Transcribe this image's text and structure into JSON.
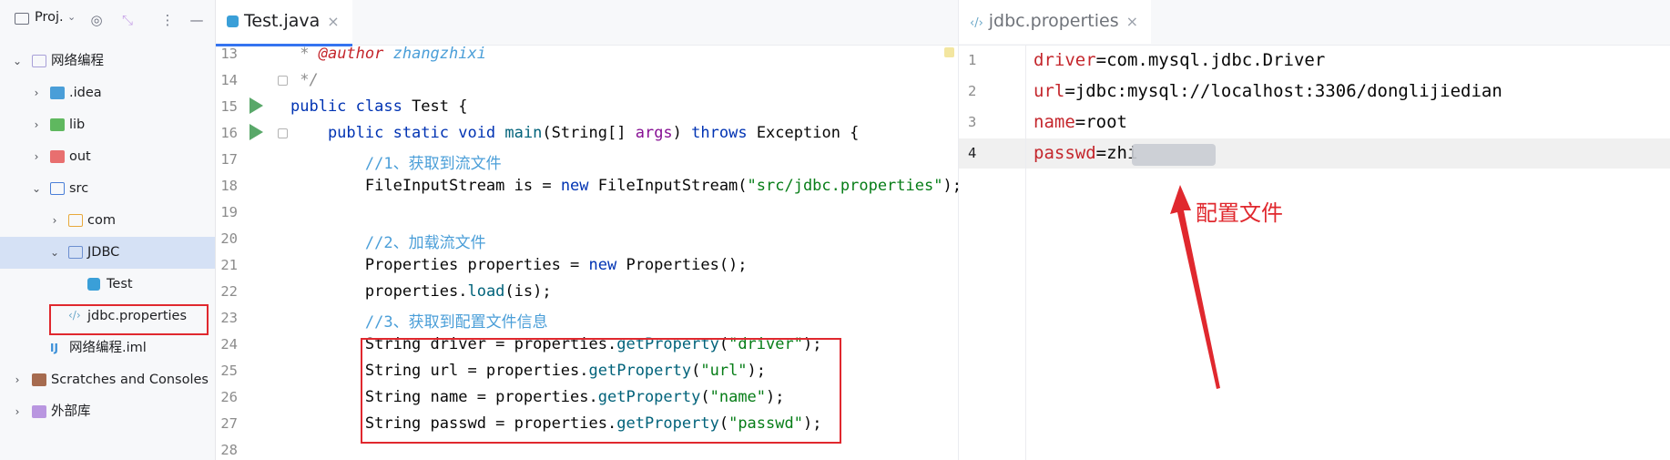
{
  "project": {
    "title": "Proj.",
    "tree": [
      {
        "label": "网络编程",
        "depth": 0,
        "expanded": true,
        "icon": "module-folder-icon"
      },
      {
        "label": ".idea",
        "depth": 1,
        "expanded": false,
        "icon": "idea-folder-icon"
      },
      {
        "label": "lib",
        "depth": 1,
        "expanded": false,
        "icon": "lib-folder-icon"
      },
      {
        "label": "out",
        "depth": 1,
        "expanded": false,
        "icon": "out-folder-icon"
      },
      {
        "label": "src",
        "depth": 1,
        "expanded": true,
        "icon": "source-folder-icon"
      },
      {
        "label": "com",
        "depth": 2,
        "expanded": false,
        "icon": "package-icon"
      },
      {
        "label": "JDBC",
        "depth": 2,
        "expanded": true,
        "icon": "package-icon",
        "selected": true
      },
      {
        "label": "Test",
        "depth": 3,
        "icon": "java-class-icon"
      },
      {
        "label": "jdbc.properties",
        "depth": 2,
        "icon": "properties-file-icon",
        "highlighted": true
      },
      {
        "label": "网络编程.iml",
        "depth": 1,
        "icon": "iml-file-icon"
      },
      {
        "label": "Scratches and Consoles",
        "depth": 0,
        "expanded": false,
        "icon": "scratches-icon"
      },
      {
        "label": "外部库",
        "depth": 0,
        "expanded": false,
        "icon": "external-libraries-icon"
      }
    ]
  },
  "editor_left": {
    "tab_label": "Test.java",
    "lines": [
      "13",
      "14",
      "15",
      "16",
      "17",
      "18",
      "19",
      "20",
      "21",
      "22",
      "23",
      "24",
      "25",
      "26",
      "27",
      "28"
    ],
    "code": {
      "l13_a": " * ",
      "l13_b": "@author",
      "l13_c": " zhangzhixi",
      "l14": " */",
      "l15_kw": "public class ",
      "l15_rest": "Test {",
      "l16_kw": "    public static void ",
      "l16_fn": "main",
      "l16_b": "(String[] ",
      "l16_par": "args",
      "l16_c": ") ",
      "l16_kw2": "throws ",
      "l16_d": "Exception {",
      "l17": "        //1、获取到流文件",
      "l18_a": "        FileInputStream is = ",
      "l18_kw": "new ",
      "l18_b": "FileInputStream(",
      "l18_str": "\"src/jdbc.properties\"",
      "l18_c": ");",
      "l20": "        //2、加载流文件",
      "l21_a": "        Properties properties = ",
      "l21_kw": "new ",
      "l21_b": "Properties();",
      "l22_a": "        properties.",
      "l22_fn": "load",
      "l22_b": "(is);",
      "l23": "        //3、获取到配置文件信息",
      "l24_a": "        String driver = properties.",
      "l24_fn": "getProperty",
      "l24_b": "(",
      "l24_str": "\"driver\"",
      "l24_c": ");",
      "l25_a": "        String url = properties.",
      "l25_fn": "getProperty",
      "l25_b": "(",
      "l25_str": "\"url\"",
      "l25_c": ");",
      "l26_a": "        String name = properties.",
      "l26_fn": "getProperty",
      "l26_b": "(",
      "l26_str": "\"name\"",
      "l26_c": ");",
      "l27_a": "        String passwd = properties.",
      "l27_fn": "getProperty",
      "l27_b": "(",
      "l27_str": "\"passwd\"",
      "l27_c": ");"
    }
  },
  "editor_right": {
    "tab_label": "jdbc.properties",
    "lines": [
      "1",
      "2",
      "3",
      "4"
    ],
    "props": [
      {
        "key": "driver",
        "eq": "=",
        "value": "com.mysql.jdbc.Driver"
      },
      {
        "key": "url",
        "eq": "=",
        "value": "jdbc:mysql://localhost:3306/donglijiedian"
      },
      {
        "key": "name",
        "eq": "=",
        "value": "root"
      },
      {
        "key": "passwd",
        "eq": "=",
        "value": "zhi"
      }
    ],
    "annotation": "配置文件"
  },
  "colors": {
    "highlight_red": "#e0282e",
    "selection": "#d5e1f5",
    "key_red": "#c4262c"
  }
}
